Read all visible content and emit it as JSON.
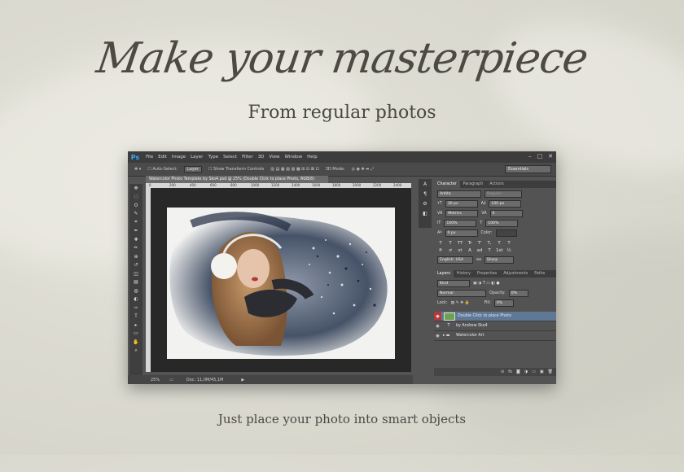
{
  "hero": {
    "headline": "Make your masterpiece",
    "subhead": "From regular photos",
    "caption": "Just place your photo into smart objects"
  },
  "app": {
    "logo": "Ps",
    "menu": [
      "File",
      "Edit",
      "Image",
      "Layer",
      "Type",
      "Select",
      "Filter",
      "3D",
      "View",
      "Window",
      "Help"
    ],
    "window_controls": [
      "–",
      "□",
      "✕"
    ],
    "options": {
      "auto_select": "Auto-Select:",
      "auto_select_target": "Layer",
      "show_transform": "Show Transform Controls",
      "mode_3d": "3D Mode:",
      "workspace": "Essentials"
    },
    "document_tab": "Watercolor Photo Template by Sko4.psd @ 25% (Double Click to place Photo, RGB/8)",
    "ruler_ticks": [
      "0",
      "200",
      "400",
      "600",
      "800",
      "1000",
      "1200",
      "1400",
      "1600",
      "1800",
      "2000",
      "2200",
      "2400"
    ],
    "status": {
      "zoom": "25%",
      "doc": "Doc: 11,0M/45,1M"
    },
    "tools": [
      "move-tool",
      "marquee-tool",
      "lasso-tool",
      "quick-select-tool",
      "crop-tool",
      "eyedropper-tool",
      "healing-tool",
      "brush-tool",
      "stamp-tool",
      "history-brush-tool",
      "eraser-tool",
      "gradient-tool",
      "blur-tool",
      "dodge-tool",
      "pen-tool",
      "type-tool",
      "path-select-tool",
      "shape-tool",
      "hand-tool",
      "zoom-tool"
    ],
    "tool_glyphs": [
      "✥",
      "◌",
      "ʘ",
      "✎",
      "⌗",
      "✒",
      "✚",
      "✏",
      "⊕",
      "↺",
      "◫",
      "▤",
      "◍",
      "◐",
      "✑",
      "T",
      "▸",
      "▭",
      "✋",
      "⌕"
    ],
    "dock_glyphs": [
      "A",
      "¶",
      "⚙",
      "◧"
    ]
  },
  "character_panel": {
    "tabs": [
      "Character",
      "Paragraph",
      "Actions"
    ],
    "font_family": "Antita",
    "font_style": "Regular",
    "font_size": "30 px",
    "leading": "100 px",
    "kerning": "Metrics",
    "tracking": "0",
    "vertical_scale": "100%",
    "horizontal_scale": "100%",
    "baseline": "0 px",
    "color_label": "Color:",
    "style_buttons": [
      "T",
      "T",
      "TT",
      "Tr",
      "T'",
      "T,",
      "T",
      "T"
    ],
    "ot_buttons": [
      "fi",
      "ơ",
      "st",
      "A",
      "ad",
      "T",
      "1st",
      "½"
    ],
    "language": "English: USA",
    "aa_label": "aa",
    "antialias": "Sharp"
  },
  "layers_panel": {
    "tabs": [
      "Layers",
      "History",
      "Properties",
      "Adjustments",
      "Paths"
    ],
    "kind": "Kind",
    "blend_mode": "Normal",
    "opacity_label": "Opacity:",
    "opacity": "0%",
    "lock_label": "Lock:",
    "fill_label": "Fill:",
    "fill": "0%",
    "layers": [
      {
        "name": "Double Click to place Photo",
        "selected": true
      },
      {
        "name": "by Andrew Sko4",
        "selected": false
      },
      {
        "name": "Watercolor Art",
        "selected": false
      }
    ],
    "footer_glyphs": [
      "⊝",
      "fx",
      "◙",
      "◑",
      "▭",
      "▣",
      "🗑"
    ]
  }
}
